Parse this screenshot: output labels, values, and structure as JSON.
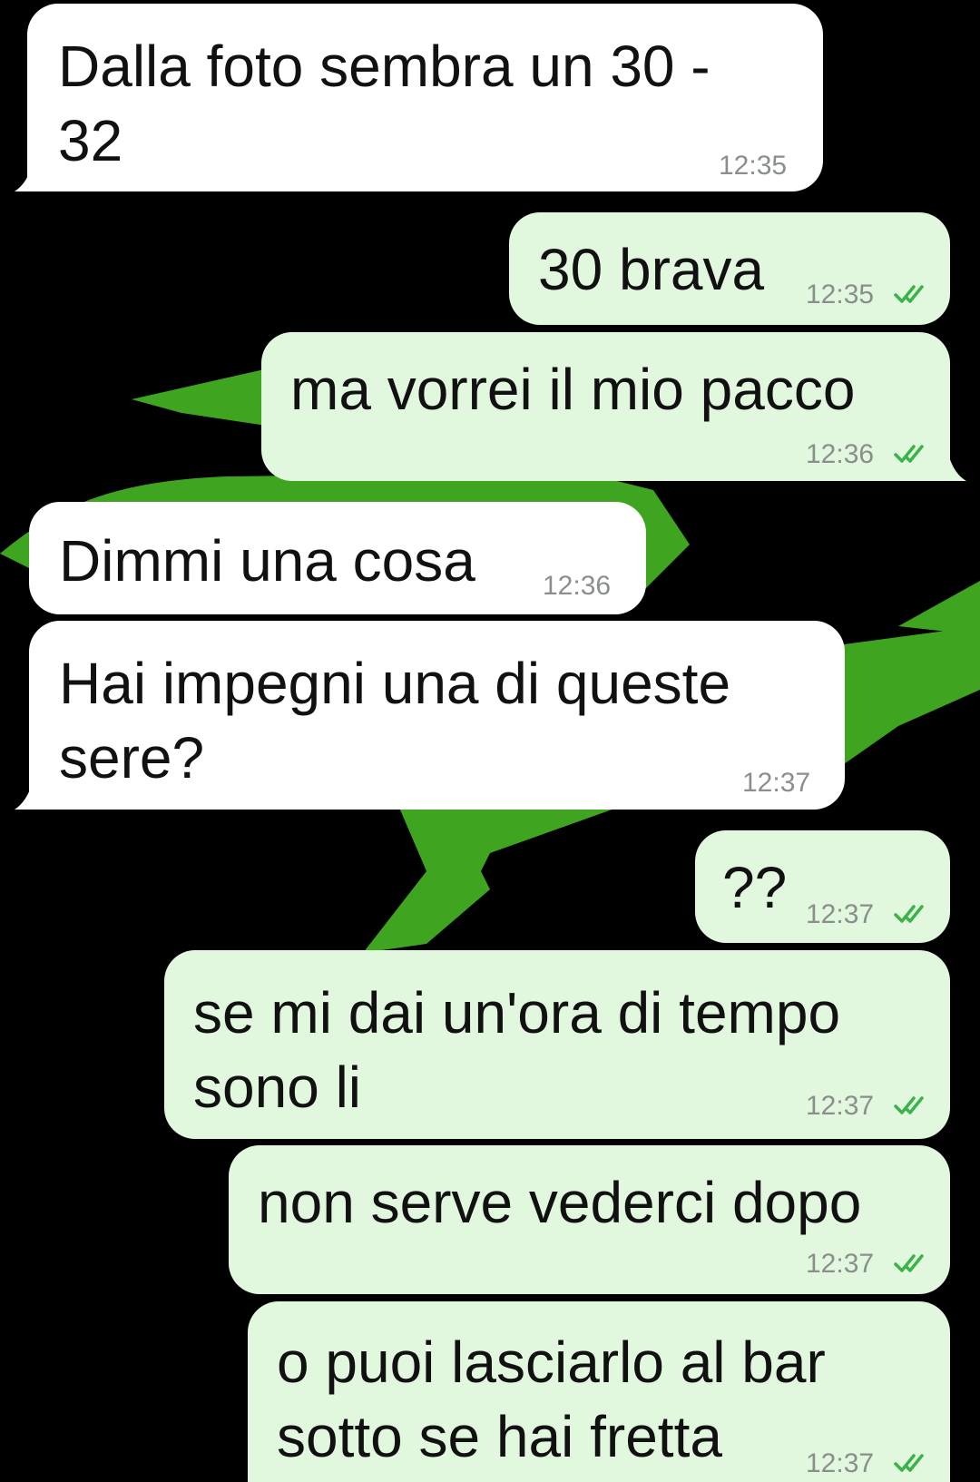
{
  "theme": {
    "background": "#000000",
    "wallpaper_accent": "#3fa41f",
    "incoming_bubble": "#ffffff",
    "outgoing_bubble": "#e1f7de",
    "read_tick_color": "#3bb34a"
  },
  "messages": [
    {
      "direction": "incoming",
      "text": "Dalla foto sembra un 30 -\n32",
      "time": "12:35"
    },
    {
      "direction": "outgoing",
      "text": "30 brava",
      "time": "12:35",
      "status_icon": "double-check-read-icon"
    },
    {
      "direction": "outgoing",
      "text": "ma vorrei il mio pacco",
      "time": "12:36",
      "status_icon": "double-check-read-icon"
    },
    {
      "direction": "incoming",
      "text": "Dimmi una cosa",
      "time": "12:36"
    },
    {
      "direction": "incoming",
      "text": "Hai impegni una di queste\nsere?",
      "time": "12:37"
    },
    {
      "direction": "outgoing",
      "text": "??",
      "time": "12:37",
      "status_icon": "double-check-read-icon"
    },
    {
      "direction": "outgoing",
      "text": "se mi dai un'ora di tempo\nsono li",
      "time": "12:37",
      "status_icon": "double-check-read-icon"
    },
    {
      "direction": "outgoing",
      "text": "non serve vederci dopo",
      "time": "12:37",
      "status_icon": "double-check-read-icon"
    },
    {
      "direction": "outgoing",
      "text": "o puoi lasciarlo al bar\nsotto se hai fretta",
      "time": "12:37",
      "status_icon": "double-check-read-icon"
    }
  ]
}
